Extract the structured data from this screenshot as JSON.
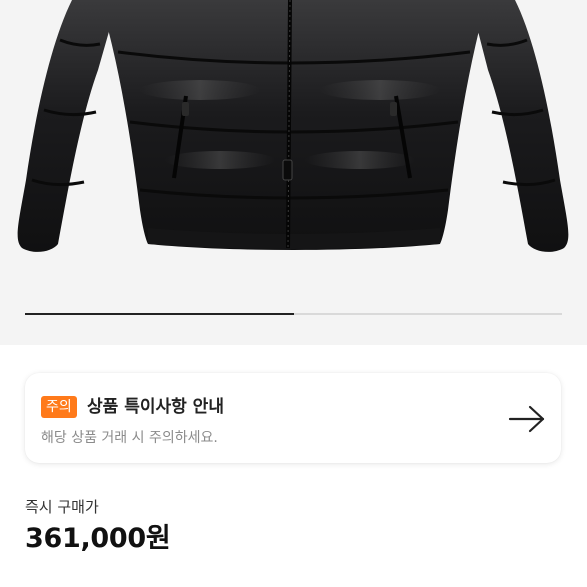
{
  "product": {
    "image_alt": "검정 패딩 점퍼",
    "gallery_progress": 0.5
  },
  "notice": {
    "badge": "주의",
    "title": "상품 특이사항 안내",
    "subtitle": "해당 상품 거래 시 주의하세요.",
    "badge_color": "#ff7a1a",
    "arrow_icon": "arrow-right-icon"
  },
  "price": {
    "label": "즉시 구매가",
    "value": "361,000원"
  }
}
